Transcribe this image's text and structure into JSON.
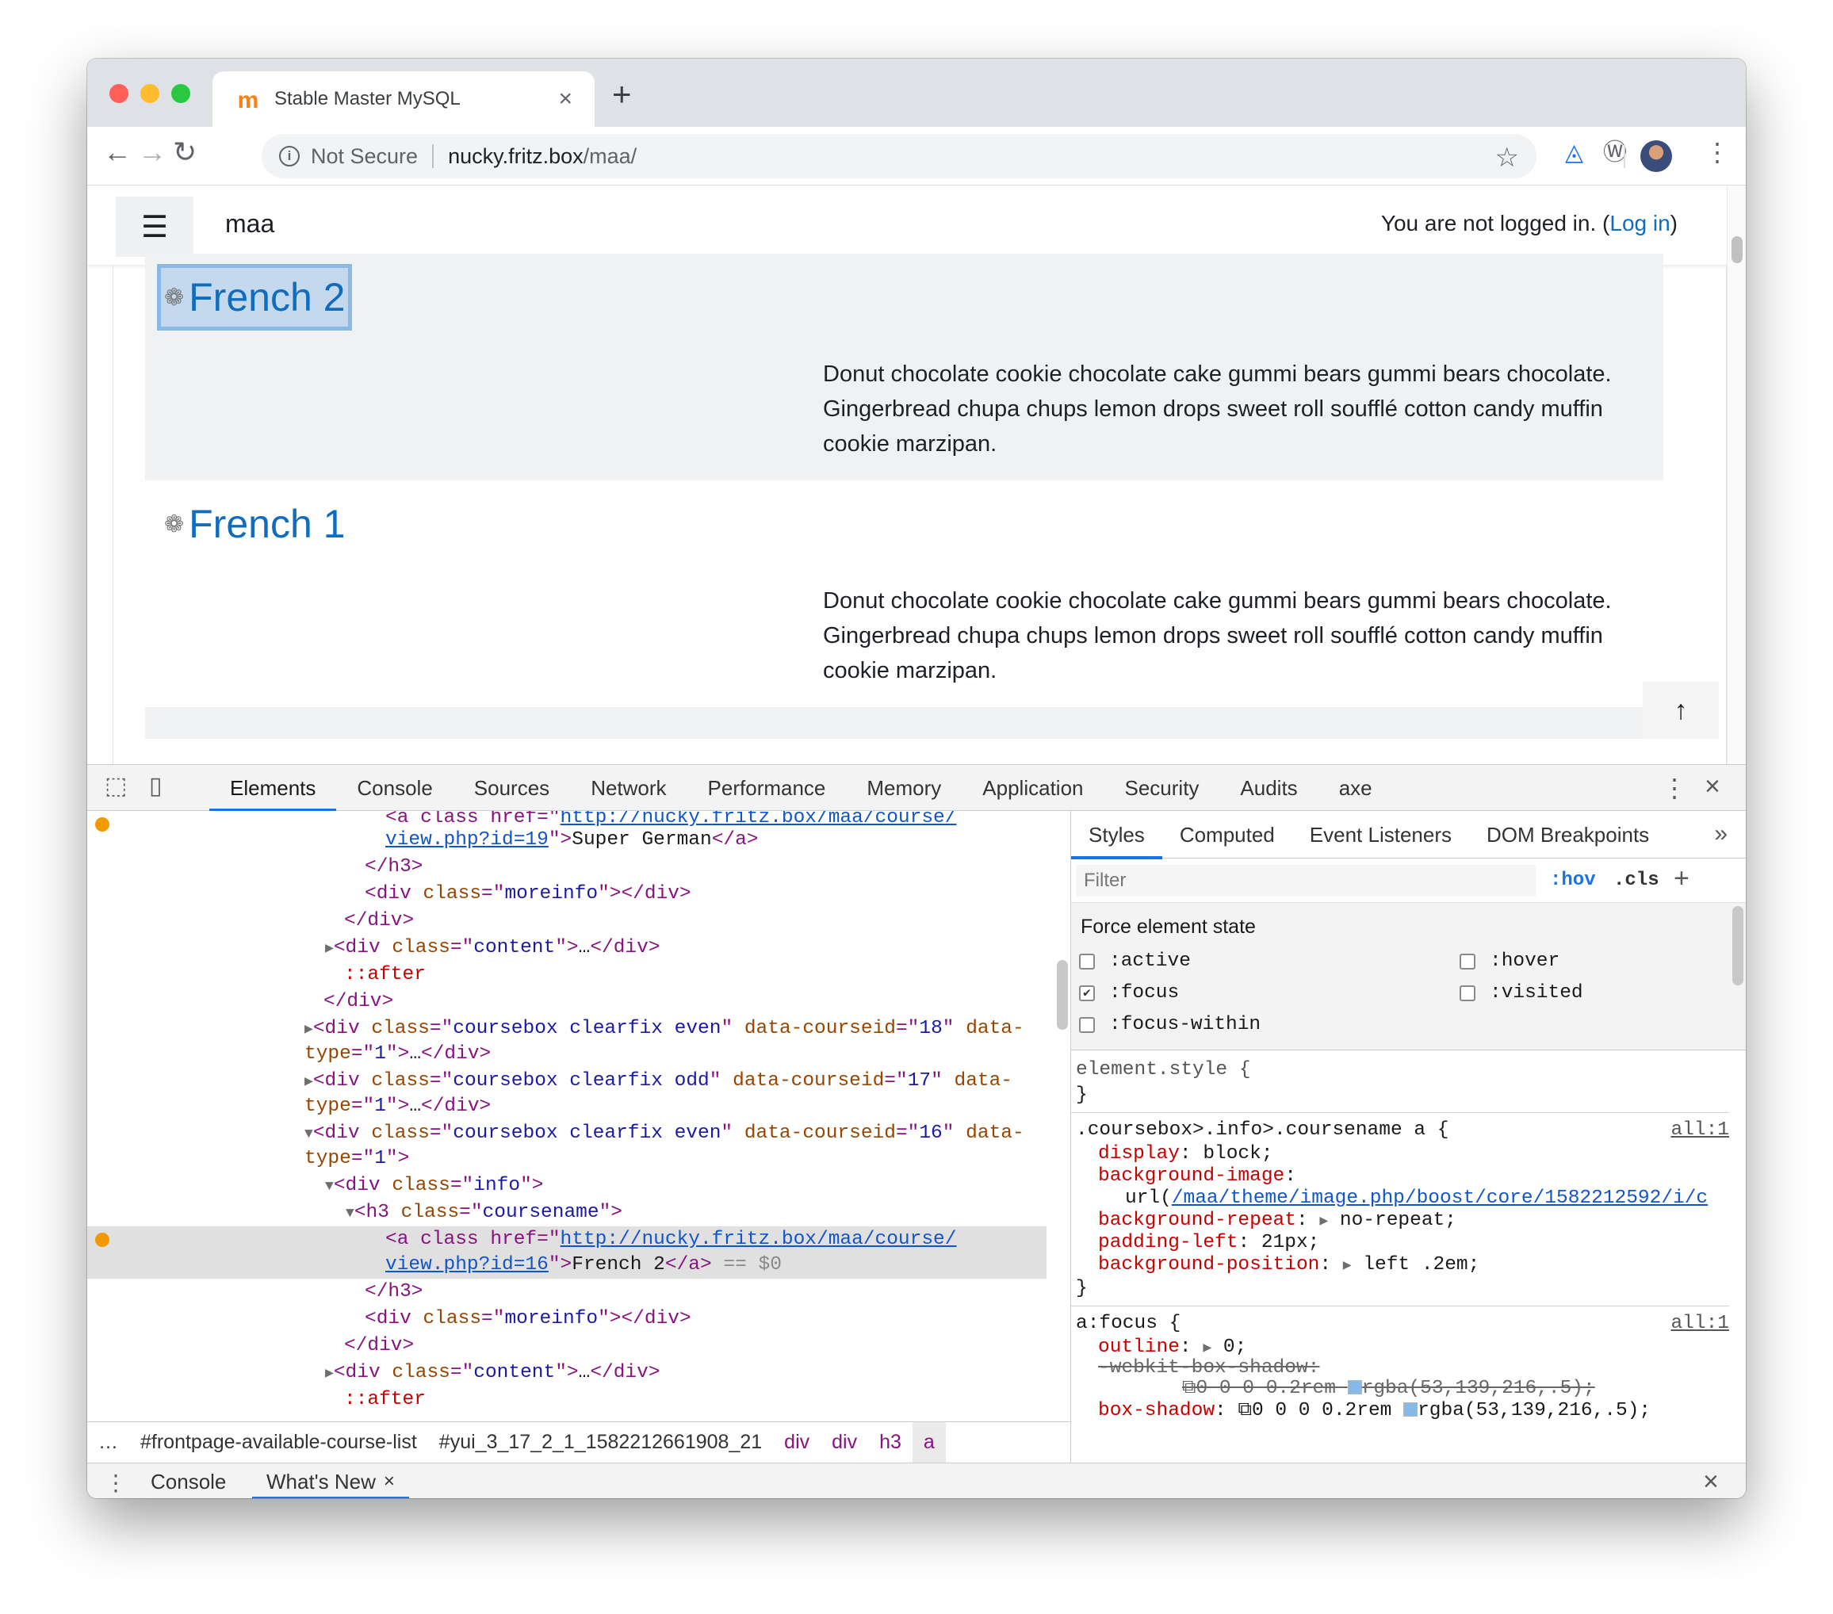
{
  "browser": {
    "tab_title": "Stable Master MySQL",
    "tab_close": "×",
    "new_tab": "+",
    "security_label": "Not Secure",
    "url_host": "nucky.fritz.box",
    "url_path": "/maa/",
    "colors": {
      "close": "#ff5f57",
      "minimize": "#febc2e",
      "maximize": "#28c840"
    }
  },
  "page": {
    "brand": "maa",
    "login_text": "You are not logged in. (",
    "login_link": "Log in",
    "login_end": ")",
    "courses": [
      {
        "name": "French 2",
        "summary": "Donut chocolate cookie chocolate cake gummi bears gummi bears chocolate. Gingerbread chupa chups lemon drops sweet roll soufflé cotton candy muffin cookie marzipan."
      },
      {
        "name": "French 1",
        "summary": "Donut chocolate cookie chocolate cake gummi bears gummi bears chocolate. Gingerbread chupa chups lemon drops sweet roll soufflé cotton candy muffin cookie marzipan."
      }
    ]
  },
  "devtools": {
    "tabs": [
      "Elements",
      "Console",
      "Sources",
      "Network",
      "Performance",
      "Memory",
      "Application",
      "Security",
      "Audits",
      "axe"
    ],
    "elements": {
      "l0a": "<a class href=\"",
      "l0b": "http://nucky.fritz.box/maa/course/",
      "l1a": "view.php?id=19",
      "l1b": "\">",
      "l1c": "Super German",
      "l1d": "</a>",
      "l2": "</h3>",
      "div_open": "<div",
      "class_attr": "class",
      "eq": "=\"",
      "q": "\"",
      "gt": ">",
      "div_close": "</div>",
      "moreinfo": "moreinfo",
      "content": "content",
      "ellipsis": "…",
      "after": "::after",
      "coursebox_even": "coursebox clearfix even",
      "coursebox_odd": "coursebox clearfix odd",
      "data_courseid": "data-courseid",
      "data_type": "data-",
      "type": "type",
      "id18": "18",
      "id17": "17",
      "id16": "16",
      "one": "1",
      "info": "info",
      "h3_open": "<h3",
      "coursename": "coursename",
      "sel_a": "<a class href=\"",
      "sel_link1": "http://nucky.fritz.box/maa/course/",
      "sel_link2": "view.php?id=16",
      "sel_text": "French 2",
      "a_close": "</a>",
      "sel_marker": " == $0"
    },
    "breadcrumbs": [
      "…",
      "#frontpage-available-course-list",
      "#yui_3_17_2_1_1582212661908_21",
      "div",
      "div",
      "h3",
      "a"
    ],
    "styles_tabs": [
      "Styles",
      "Computed",
      "Event Listeners",
      "DOM Breakpoints"
    ],
    "filter_placeholder": "Filter",
    "hov": ":hov",
    "cls": ".cls",
    "force_title": "Force element state",
    "states": {
      "active": ":active",
      "hover": ":hover",
      "focus": ":focus",
      "visited": ":visited",
      "focus_within": ":focus-within"
    },
    "rules": {
      "element_style": "element.style {",
      "close_brace": "}",
      "r1_selector": ".coursebox>.info>.coursename a {",
      "r1_source": "all:1",
      "r1_p1": "display",
      "r1_v1": "block",
      "r1_p2": "background-image",
      "r1_v2a": "url(",
      "r1_v2b": "/maa/theme/image.php/boost/core/1582212592/i/c",
      "r1_p3": "background-repeat",
      "r1_v3": "no-repeat",
      "r1_p4": "padding-left",
      "r1_v4": "21px",
      "r1_p5": "background-position",
      "r1_v5": "left .2em",
      "r2_selector": "a:focus {",
      "r2_source": "all:1",
      "r2_p1": "outline",
      "r2_v1": "0",
      "r2_p2": "-webkit-box-shadow:",
      "r2_v2": "0 0 0 0.2rem ",
      "r2_v2c": "rgba(53,139,216,.5);",
      "r2_p3": "box-shadow",
      "r2_v3": "0 0 0 0.2rem ",
      "r2_v3c": "rgba(53,139,216,.5);"
    },
    "drawer_tabs": [
      "Console",
      "What's New"
    ],
    "drawer_close": "×"
  }
}
